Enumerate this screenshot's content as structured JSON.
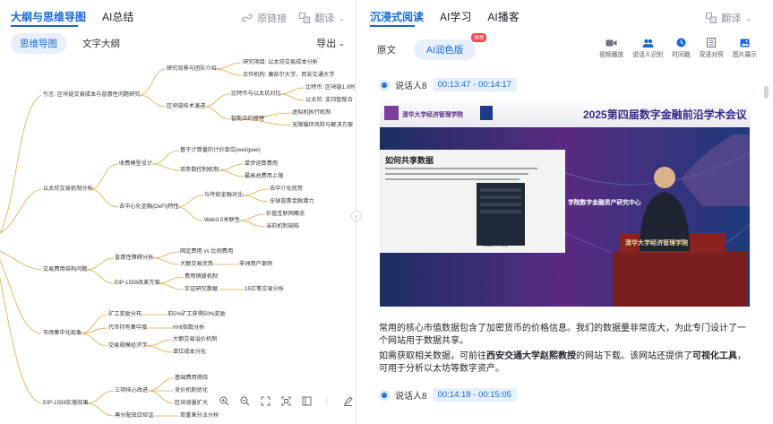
{
  "left": {
    "tabs": [
      "大纲与思维导图",
      "AI总结"
    ],
    "tools": {
      "link": "原链接",
      "translate": "翻译"
    },
    "subtabs": [
      "思维导图",
      "文字大纲"
    ],
    "export": "导出",
    "mindmap": [
      "引言: 区块链交易成本与普惠性问题研究",
      "研究背景与团队介绍",
      "研究项目: 以太坊交易成本分析",
      "合作机构: 康奈尔大学、西安交通大学",
      "区块链技术演进",
      "比特币与以太坊对比",
      "比特币: 区块链1.0时",
      "以太坊: 支持智能合",
      "智能合约原理",
      "虚拟机执行机制",
      "无限循环风险与解决方案",
      "以太坊交易机制分析",
      "收费模型设计",
      "基于计算量的计价单位(wei/gwei)",
      "双参数控制机制",
      "单步运算费用",
      "最高总费用上限",
      "去中心化金融(DeFi)特性",
      "与传统金融对比",
      "去中介化优势",
      "全球普惠金融潜力",
      "Web3.0关联性",
      "价值互联网概念",
      "当前机制缺陷",
      "交易费用结构问题",
      "普惠性障碍分析",
      "固定费用 vs 比例费用",
      "大额交易优势",
      "非洲用户案例",
      "EIP-1559改革方案",
      "费用销毁机制",
      "实证研究数据",
      "15亿笔交易分析",
      "市场集中化现象",
      "矿工奖励分布",
      "前5%矿工获得50%奖励",
      "代币持有集中度",
      "HHI指数分析",
      "交易规模经济学",
      "大额交易溢价机制",
      "单位成本分化",
      "EIP-1559实施效果",
      "三项核心改进",
      "基础费用燃烧",
      "竞价机制优化",
      "区块容量扩大",
      "再分配效应验证",
      "双重差分法分析"
    ],
    "collapse": "‹"
  },
  "right": {
    "tabs": [
      "沉浸式阅读",
      "AI学习",
      "AI播客"
    ],
    "translate": "翻译",
    "subtabs": [
      "原文",
      "AI润色版"
    ],
    "new_badge": "推荐",
    "tools": [
      "视频播放",
      "说话人识别",
      "时间戳",
      "双语对照",
      "图片展示"
    ],
    "segments": [
      {
        "speaker": "说话人8",
        "time": "00:13:47 - 00:14:17"
      },
      {
        "speaker": "说话人8",
        "time": "00:14:18 - 00:15:05"
      }
    ],
    "video": {
      "banner_title": "2025第四届数字金融前沿学术会议",
      "school": "清华大学经济管理学院",
      "slide_title": "如何共享数据",
      "slide_caption": "Data API Key",
      "bg_text": "学院数字金融资产研究中心",
      "podium": "清华大学经济管理学院"
    },
    "paragraphs": [
      {
        "pre": "常用的核心市值数据包含了加密货币的价格信息。我们的数据量非常庞大，为此专门设计了一个网站用于数据共享。"
      },
      {
        "pre": "如需获取相关数据，可前往",
        "b1": "西安交通大学赵熙教授",
        "mid": "的网站下载。该网站还提供了",
        "b2": "可视化工具",
        "post": "，可用于分析以太坊等数字资产。"
      }
    ]
  },
  "colors": {
    "accent": "#1769d8",
    "branch": "#e8a940",
    "video_bg": "#1d3a6e"
  }
}
